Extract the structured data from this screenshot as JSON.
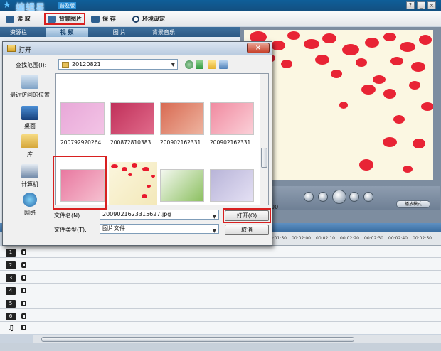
{
  "app": {
    "title": "编辑星",
    "edition": "普及版",
    "window_controls": [
      "?",
      "_",
      "×"
    ]
  },
  "toolbar": {
    "items": [
      {
        "label": "读 取",
        "icon": "folder-open-icon"
      },
      {
        "label": "背景图片",
        "icon": "image-icon"
      },
      {
        "label": "保 存",
        "icon": "save-icon"
      },
      {
        "label": "环境设定",
        "icon": "settings-icon"
      }
    ]
  },
  "panel_tabs": {
    "resource": "资源栏",
    "video": "视 频",
    "image": "图 片",
    "music": "背景音乐"
  },
  "preview": {
    "time": "00",
    "mode_button": "播放模式"
  },
  "timeline": {
    "ticks": [
      "00:01:50",
      "00:02:00",
      "00:02:10",
      "00:02:20",
      "00:02:30",
      "00:02:40",
      "00:02:50"
    ],
    "tracks": [
      "1",
      "2",
      "3",
      "4",
      "5",
      "6",
      "♫"
    ]
  },
  "dialog": {
    "title": "打开",
    "close_label": "×",
    "lookin_label": "查找范围(I):",
    "lookin_value": "20120821",
    "places": [
      "最近访问的位置",
      "桌面",
      "库",
      "计算机",
      "网络"
    ],
    "files": [
      {
        "name": "200792920264...",
        "colors": [
          "#e8a8d8",
          "#f3c4e6"
        ]
      },
      {
        "name": "200872810383...",
        "colors": [
          "#c0305a",
          "#e06a8a"
        ]
      },
      {
        "name": "200902162331...",
        "colors": [
          "#d86a52",
          "#eeb4a0"
        ]
      },
      {
        "name": "200902162331...",
        "colors": [
          "#f08aa0",
          "#fbd0d8"
        ]
      },
      {
        "name": "",
        "colors": [
          "#e878a0",
          "#f6c0d0"
        ]
      },
      {
        "name": "",
        "colors": [
          "#fbf6de",
          "#f3e8b8"
        ]
      },
      {
        "name": "",
        "colors": [
          "#f4f8f0",
          "#8cc060"
        ]
      },
      {
        "name": "",
        "colors": [
          "#b8b4d8",
          "#e4e0f4"
        ]
      }
    ],
    "filename_label": "文件名(N):",
    "filename_value": "2009021623315627.jpg",
    "filetype_label": "文件类型(T):",
    "filetype_value": "图片文件",
    "open_button": "打开(O)",
    "cancel_button": "取消"
  },
  "colors": {
    "titlebar": "#134e7f",
    "highlight": "#d82020",
    "petal": "#e8192c",
    "preview_bg": "#fbf7e2"
  }
}
